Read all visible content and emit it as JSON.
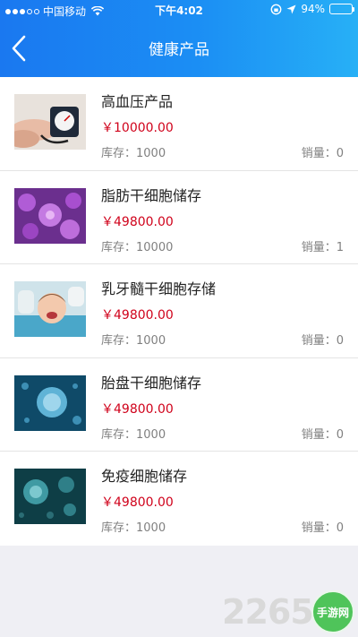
{
  "status_bar": {
    "carrier": "中国移动",
    "time": "下午4:02",
    "battery": "94%"
  },
  "nav": {
    "title": "健康产品",
    "back_icon": "chevron-left-icon"
  },
  "products": [
    {
      "name": "高血压产品",
      "price": "￥10000.00",
      "stock": "库存：1000",
      "sales": "销量：0",
      "image": "blood-pressure-monitor"
    },
    {
      "name": "脂肪干细胞储存",
      "price": "￥49800.00",
      "stock": "库存：10000",
      "sales": "销量：1",
      "image": "purple-cells"
    },
    {
      "name": "乳牙髓干细胞存储",
      "price": "￥49800.00",
      "stock": "库存：1000",
      "sales": "销量：0",
      "image": "child-dentist"
    },
    {
      "name": "胎盘干细胞储存",
      "price": "￥49800.00",
      "stock": "库存：1000",
      "sales": "销量：0",
      "image": "blue-cell"
    },
    {
      "name": "免疫细胞储存",
      "price": "￥49800.00",
      "stock": "库存：1000",
      "sales": "销量：0",
      "image": "teal-cells"
    }
  ],
  "watermark": {
    "number": "2265",
    "badge": "手游网"
  },
  "colors": {
    "header_gradient_start": "#1a78f0",
    "header_gradient_end": "#27b0f6",
    "price": "#d0021b",
    "muted": "#808080"
  }
}
